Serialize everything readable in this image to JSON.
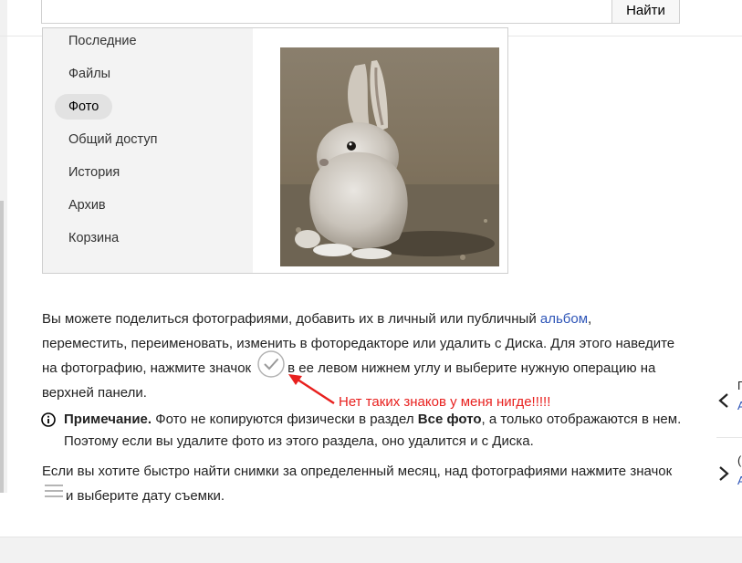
{
  "search": {
    "button_label": "Найти",
    "value": ""
  },
  "nav": [
    {
      "label": "Последние",
      "active": false
    },
    {
      "label": "Файлы",
      "active": false
    },
    {
      "label": "Фото",
      "active": true
    },
    {
      "label": "Общий доступ",
      "active": false
    },
    {
      "label": "История",
      "active": false
    },
    {
      "label": "Архив",
      "active": false
    },
    {
      "label": "Корзина",
      "active": false
    }
  ],
  "article": {
    "p1_a": "Вы можете поделиться фотографиями, добавить их в личный или публичный ",
    "p1_link": "альбом",
    "p1_b": ",",
    "p1_c": "переместить, переименовать, изменить в фоторедакторе или удалить с Диска. Для этого наведите",
    "p1_d": "на фотографию, нажмите значок",
    "p1_e": "в ее левом нижнем углу и выберите нужную операцию на",
    "p1_f": "верхней панели.",
    "note_label": "Примечание.",
    "note_a": " Фото не копируются физически в раздел ",
    "note_bold": "Все фото",
    "note_b": ", а только отображаются в нем.",
    "note_c": "Поэтому если вы удалите фото из этого раздела, оно удалится и с Диска.",
    "p2_a": "Если вы хотите быстро найти снимки за определенный месяц, над фотографиями нажмите значок",
    "p2_b": "и выберите дату съемки."
  },
  "annotation": "Нет таких знаков у меня нигде!!!!!",
  "right_panel": {
    "frag1": "П",
    "frag2": "А",
    "frag3": "(",
    "frag4": "А"
  },
  "colors": {
    "link": "#2f56b8",
    "annotation": "#e8201e",
    "active_nav": "#e2e2e2"
  }
}
